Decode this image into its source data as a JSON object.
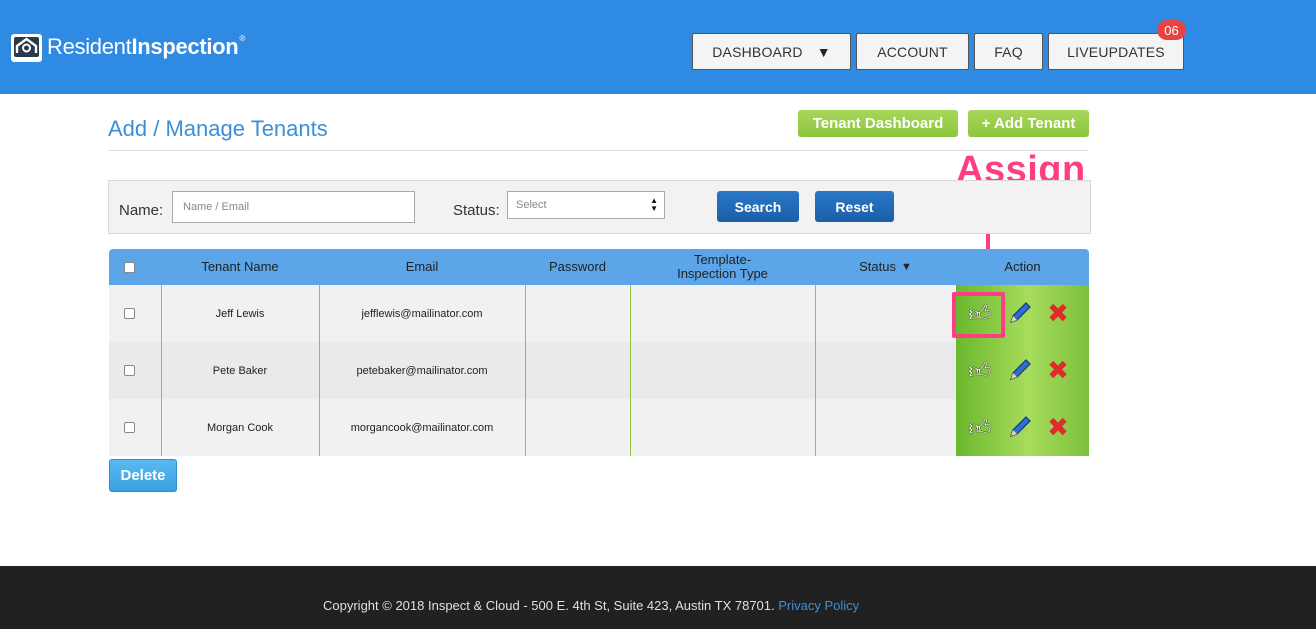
{
  "brand": {
    "name_part1": "Resident",
    "name_part2": "Inspection",
    "reg": "®",
    "color": "#2e8ae2"
  },
  "nav": {
    "dashboard": "DASHBOARD",
    "dashboard_caret": "▼",
    "account": "ACCOUNT",
    "faq": "FAQ",
    "liveupdates": "LIVEUPDATES",
    "liveupdates_badge": "06"
  },
  "page": {
    "title": "Add / Manage Tenants",
    "tenant_dashboard_btn": "Tenant Dashboard",
    "add_tenant_btn": "+ Add Tenant",
    "annotation": "Assign"
  },
  "filter": {
    "name_label": "Name:",
    "name_placeholder": "Name / Email",
    "status_label": "Status:",
    "status_value": "Select",
    "search_btn": "Search",
    "reset_btn": "Reset"
  },
  "table": {
    "headers": {
      "tenant_name": "Tenant Name",
      "email": "Email",
      "password": "Password",
      "template_line1": "Template-",
      "template_line2": "Inspection Type",
      "status": "Status",
      "status_caret": "▼",
      "action": "Action"
    },
    "rows": [
      {
        "name": "Jeff Lewis",
        "email": "jefflewis@mailinator.com",
        "password": "",
        "template": "",
        "status": ""
      },
      {
        "name": "Pete Baker",
        "email": "petebaker@mailinator.com",
        "password": "",
        "template": "",
        "status": ""
      },
      {
        "name": "Morgan Cook",
        "email": "morgancook@mailinator.com",
        "password": "",
        "template": "",
        "status": ""
      }
    ],
    "icons": {
      "assign": "thumbs-up-icon",
      "edit": "pencil-icon",
      "delete": "red-x-icon"
    }
  },
  "delete_btn": "Delete",
  "footer": {
    "copyright": "Copyright © 2018 Inspect & Cloud - 500 E. 4th St, Suite 423, Austin TX 78701. ",
    "privacy": "Privacy Policy"
  },
  "colors": {
    "header_blue": "#2e8ae2",
    "title_blue": "#3b8fd9",
    "green": "#8cc63f",
    "annotation_pink": "#ff3d82",
    "footer_bg": "#212121"
  }
}
